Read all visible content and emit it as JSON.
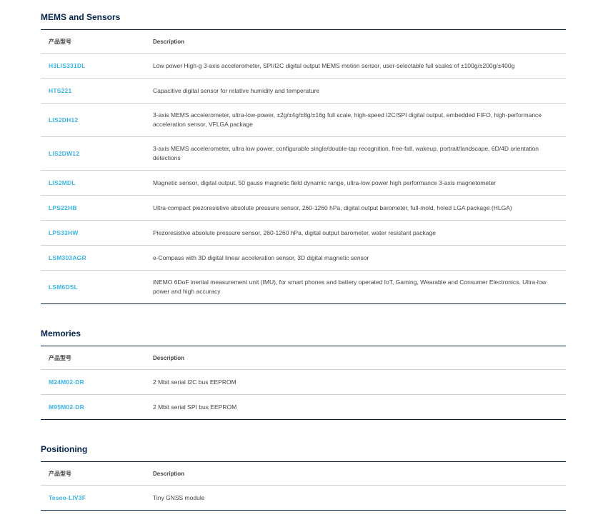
{
  "table_headers": {
    "part": "产品型号",
    "description": "Description"
  },
  "sections": [
    {
      "title": "MEMS and Sensors",
      "rows": [
        {
          "part": "H3LIS331DL",
          "description": "Low power High-g 3-axis accelerometer, SPI/I2C digital output MEMS motion sensor, user-selectable full scales of ±100g/±200g/±400g"
        },
        {
          "part": "HTS221",
          "description": "Capacitive digital sensor for relative humidity and temperature"
        },
        {
          "part": "LIS2DH12",
          "description": "3-axis MEMS accelerometer, ultra-low-power, ±2g/±4g/±8g/±16g full scale, high-speed I2C/SPI digital output, embedded FIFO, high-performance acceleration sensor, VFLGA package"
        },
        {
          "part": "LIS2DW12",
          "description": "3-axis MEMS accelerometer, ultra low power, configurable single/double-tap recognition, free-fall, wakeup, portrait/landscape, 6D/4D orientation detections"
        },
        {
          "part": "LIS2MDL",
          "description": "Magnetic sensor, digital output, 50 gauss magnetic field dynamic range, ultra-low power high performance 3-axis magnetometer"
        },
        {
          "part": "LPS22HB",
          "description": "Ultra-compact piezoresistive absolute pressure sensor, 260-1260 hPa, digital output barometer, full-mold, holed LGA package (HLGA)"
        },
        {
          "part": "LPS33HW",
          "description": "Piezoresistive absolute pressure sensor, 260-1260 hPa, digital output barometer, water resistant package"
        },
        {
          "part": "LSM303AGR",
          "description": "e-Compass with 3D digital linear acceleration sensor, 3D digital magnetic sensor"
        },
        {
          "part": "LSM6DSL",
          "description": "iNEMO 6DoF inertial measurement unit (IMU), for smart phones and battery operated IoT, Gaming, Wearable and Consumer Electronics. Ultra-low power and high accuracy"
        }
      ]
    },
    {
      "title": "Memories",
      "rows": [
        {
          "part": "M24M02-DR",
          "description": "2 Mbit serial I2C bus EEPROM"
        },
        {
          "part": "M95M02-DR",
          "description": "2 Mbit serial SPI bus EEPROM"
        }
      ]
    },
    {
      "title": "Positioning",
      "rows": [
        {
          "part": "Teseo-LIV3F",
          "description": "Tiny GNSS module"
        }
      ]
    }
  ],
  "colors": {
    "heading": "#03234b",
    "link": "#3cb4e6",
    "rule": "#03234b",
    "row_divider": "#d0d0d0"
  }
}
